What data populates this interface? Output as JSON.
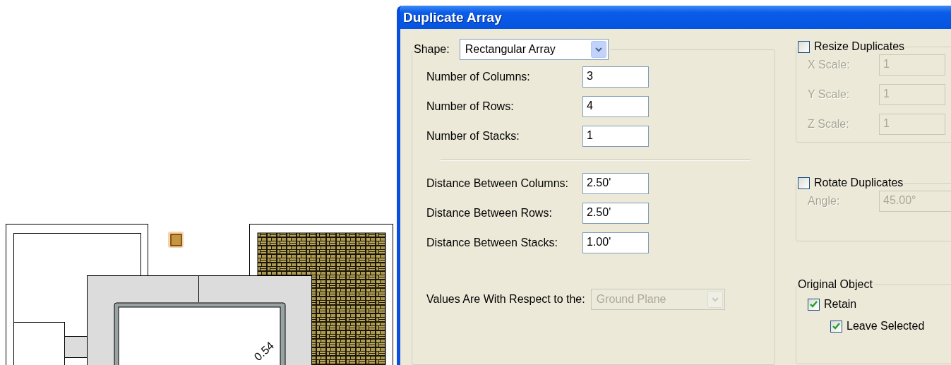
{
  "canvas": {
    "dimension": "0.54"
  },
  "window": {
    "title": "Duplicate Array"
  },
  "shape": {
    "label": "Shape:",
    "value": "Rectangular Array"
  },
  "counts": [
    {
      "label": "Number of Columns:",
      "value": "3"
    },
    {
      "label": "Number of Rows:",
      "value": "4"
    },
    {
      "label": "Number of Stacks:",
      "value": "1"
    }
  ],
  "distances": [
    {
      "label": "Distance Between Columns:",
      "value": "2.50'"
    },
    {
      "label": "Distance Between Rows:",
      "value": "2.50'"
    },
    {
      "label": "Distance Between Stacks:",
      "value": "1.00'"
    }
  ],
  "reference": {
    "label": "Values Are With Respect to the:",
    "value": "Ground Plane",
    "disabled": true
  },
  "resize": {
    "label": "Resize Duplicates",
    "checked": false,
    "fields": [
      {
        "label": "X Scale:",
        "value": "1"
      },
      {
        "label": "Y Scale:",
        "value": "1"
      },
      {
        "label": "Z Scale:",
        "value": "1"
      }
    ]
  },
  "rotate": {
    "label": "Rotate Duplicates",
    "checked": false,
    "fields": [
      {
        "label": "Angle:",
        "value": "45.00°"
      }
    ]
  },
  "original_object": {
    "title": "Original Object",
    "options": [
      {
        "label": "Retain",
        "checked": true,
        "children": [
          {
            "label": "Leave Selected",
            "checked": true
          }
        ]
      }
    ]
  }
}
